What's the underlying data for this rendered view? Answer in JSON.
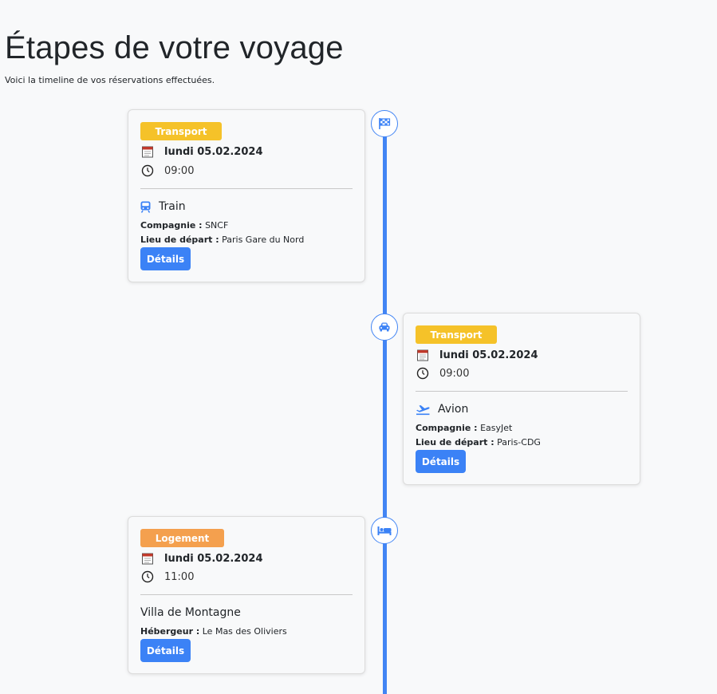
{
  "header": {
    "title": "Étapes de votre voyage",
    "subtitle": "Voici la timeline de vos réservations effectuées."
  },
  "colors": {
    "timeline": "#4285f4",
    "transport_badge": "#f5c229",
    "logement_badge": "#f4a04e",
    "button": "#3b82f6"
  },
  "timeline": [
    {
      "marker_icon": "checkered-flag-icon",
      "badge": "Transport",
      "date": "lundi 05.02.2024",
      "time": "09:00",
      "mode_icon": "train-icon",
      "mode": "Train",
      "fields": [
        {
          "label": "Compagnie :",
          "value": "SNCF"
        },
        {
          "label": "Lieu de départ :",
          "value": "Paris Gare du Nord"
        }
      ],
      "button": "Détails"
    },
    {
      "marker_icon": "car-icon",
      "badge": "Transport",
      "date": "lundi 05.02.2024",
      "time": "09:00",
      "mode_icon": "plane-icon",
      "mode": "Avion",
      "fields": [
        {
          "label": "Compagnie :",
          "value": "EasyJet"
        },
        {
          "label": "Lieu de départ :",
          "value": "Paris-CDG"
        }
      ],
      "button": "Détails"
    },
    {
      "marker_icon": "bed-icon",
      "badge": "Logement",
      "date": "lundi 05.02.2024",
      "time": "11:00",
      "mode": "Villa de Montagne",
      "fields": [
        {
          "label": "Hébergeur :",
          "value": "Le Mas des Oliviers"
        }
      ],
      "button": "Détails"
    }
  ]
}
